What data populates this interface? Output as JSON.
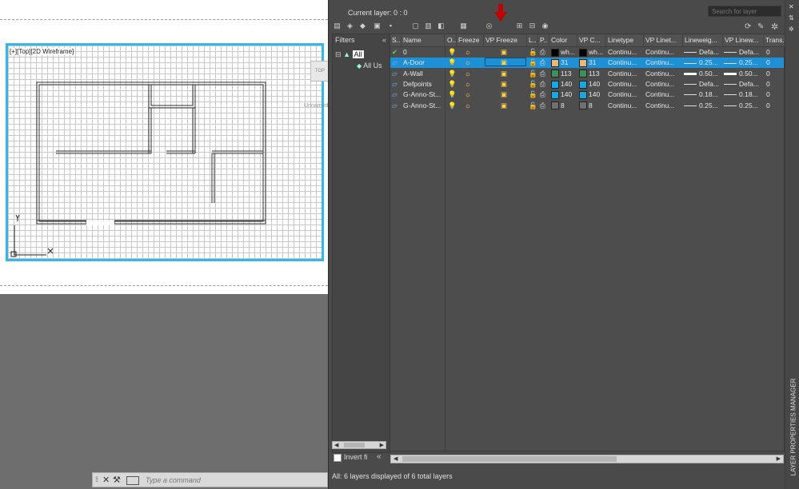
{
  "drawing": {
    "viewport_label": "[+][Top][2D Wireframe]",
    "viewcube_label": "TOP",
    "unnamed_label": "Unnamed",
    "axis_y": "Y",
    "axis_x": "X"
  },
  "command_line": {
    "placeholder": "Type a command"
  },
  "palette": {
    "current_layer_label": "Current layer: 0 : 0",
    "search_placeholder": "Search for layer",
    "side_title": "LAYER PROPERTIES MANAGER",
    "filters_label": "Filters",
    "tree": {
      "root": "All",
      "child": "All Us"
    },
    "invert_filter_label": "Invert fi",
    "status_text": "All: 6 layers displayed of 6 total layers",
    "columns": [
      "S..",
      "Name",
      "O..",
      "Freeze",
      "VP Freeze",
      "L..",
      "P..",
      "Color",
      "VP C...",
      "Linetype",
      "VP Linet...",
      "Lineweig...",
      "VP Linew...",
      "Trans..."
    ],
    "layers": [
      {
        "name": "0",
        "color_num": "wh...",
        "color_hex": "#000000",
        "vp_color": "wh...",
        "vp_color_hex": "#000000",
        "linetype": "Continu...",
        "vp_linetype": "Continu...",
        "lineweight": "Defa...",
        "vp_lineweight": "Defa...",
        "trans": "0",
        "current": true,
        "selected": false,
        "lw_thick": false
      },
      {
        "name": "A-Door",
        "color_num": "31",
        "color_hex": "#e8b87a",
        "vp_color": "31",
        "vp_color_hex": "#e8b87a",
        "linetype": "Continu...",
        "vp_linetype": "Continu...",
        "lineweight": "0.25...",
        "vp_lineweight": "0.25...",
        "trans": "0",
        "current": false,
        "selected": true,
        "lw_thick": false
      },
      {
        "name": "A-Wall",
        "color_num": "113",
        "color_hex": "#3f8f5a",
        "vp_color": "113",
        "vp_color_hex": "#3f8f5a",
        "linetype": "Continu...",
        "vp_linetype": "Continu...",
        "lineweight": "0.50...",
        "vp_lineweight": "0.50...",
        "trans": "0",
        "current": false,
        "selected": false,
        "lw_thick": true
      },
      {
        "name": "Defpoints",
        "color_num": "140",
        "color_hex": "#1aa6e0",
        "vp_color": "140",
        "vp_color_hex": "#1aa6e0",
        "linetype": "Continu...",
        "vp_linetype": "Continu...",
        "lineweight": "Defa...",
        "vp_lineweight": "Defa...",
        "trans": "0",
        "current": false,
        "selected": false,
        "lw_thick": false
      },
      {
        "name": "G-Anno-St...",
        "color_num": "140",
        "color_hex": "#1aa6e0",
        "vp_color": "140",
        "vp_color_hex": "#1aa6e0",
        "linetype": "Continu...",
        "vp_linetype": "Continu...",
        "lineweight": "0.18...",
        "vp_lineweight": "0.18...",
        "trans": "0",
        "current": false,
        "selected": false,
        "lw_thick": false
      },
      {
        "name": "G-Anno-St...",
        "color_num": "8",
        "color_hex": "#707070",
        "vp_color": "8",
        "vp_color_hex": "#707070",
        "linetype": "Continu...",
        "vp_linetype": "Continu...",
        "lineweight": "0.25...",
        "vp_lineweight": "0.25...",
        "trans": "0",
        "current": false,
        "selected": false,
        "lw_thick": false
      }
    ]
  },
  "colors": {
    "accent": "#1e90d6",
    "viewport_border": "#35b7e8",
    "arrow": "#c00000"
  }
}
